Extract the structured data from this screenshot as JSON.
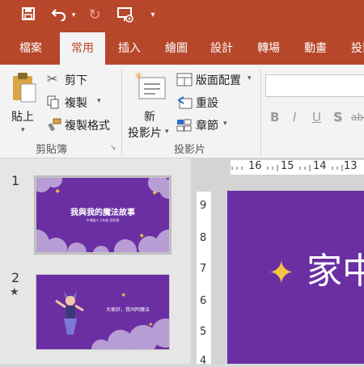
{
  "qat": {
    "save_icon": "save-icon",
    "undo_icon": "undo-icon",
    "redo_icon": "redo-icon",
    "present_icon": "present-from-beginning-icon",
    "customize_icon": "customize-toolbar-icon"
  },
  "tabs": [
    "檔案",
    "常用",
    "插入",
    "繪圖",
    "設計",
    "轉場",
    "動畫",
    "投影"
  ],
  "active_tab": "常用",
  "ribbon": {
    "clipboard": {
      "paste": "貼上",
      "cut": "剪下",
      "copy": "複製",
      "format_painter": "複製格式",
      "group_label": "剪貼簿"
    },
    "slides": {
      "new_slide_line1": "新",
      "new_slide_line2": "投影片",
      "layout": "版面配置",
      "reset": "重設",
      "section": "章節",
      "group_label": "投影片"
    },
    "font": {
      "bold": "B",
      "italic": "I",
      "underline": "U",
      "shadow": "S",
      "strike": "abc"
    }
  },
  "slides": [
    {
      "number": "1",
      "title": "我與我的魔法故事",
      "subtitle": "中埔國小 2年級 邱宥蓁"
    },
    {
      "number": "2",
      "mark": "★",
      "text": "大家好，我叫阿魔法"
    }
  ],
  "rulers": {
    "horizontal": [
      "16",
      "15",
      "14",
      "13"
    ],
    "vertical": [
      "9",
      "8",
      "7",
      "6",
      "5",
      "4"
    ]
  },
  "main_slide": {
    "text": "家中",
    "sparkle": "✦"
  },
  "colors": {
    "accent": "#b7472a",
    "slide_bg": "#6b2fa3",
    "cloud": "#b79dd3",
    "sparkle": "#f5c542"
  }
}
